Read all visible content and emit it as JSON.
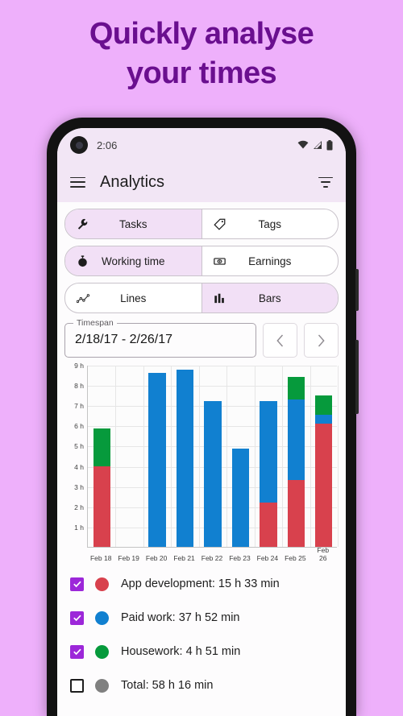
{
  "headline": {
    "line1": "Quickly analyse",
    "line2": "your times",
    "color": "#6a0f8f"
  },
  "status_bar": {
    "time": "2:06",
    "icons": [
      "wifi-icon",
      "signal-icon",
      "battery-icon"
    ]
  },
  "app_bar": {
    "title": "Analytics",
    "menu_icon": "hamburger-menu-icon",
    "filter_icon": "filter-icon"
  },
  "toggles": [
    {
      "left": {
        "label": "Tasks",
        "icon": "wrench-icon",
        "selected": true
      },
      "right": {
        "label": "Tags",
        "icon": "tag-icon",
        "selected": false
      }
    },
    {
      "left": {
        "label": "Working time",
        "icon": "stopwatch-icon",
        "selected": true
      },
      "right": {
        "label": "Earnings",
        "icon": "money-icon",
        "selected": false
      }
    },
    {
      "left": {
        "label": "Lines",
        "icon": "line-chart-icon",
        "selected": false
      },
      "right": {
        "label": "Bars",
        "icon": "bar-chart-icon",
        "selected": true
      }
    }
  ],
  "timespan": {
    "label": "Timespan",
    "value": "2/18/17 - 2/26/17",
    "prev_label": "‹",
    "next_label": "›"
  },
  "chart_data": {
    "type": "bar",
    "stacked": true,
    "title": "",
    "xlabel": "",
    "ylabel": "",
    "ylim": [
      0,
      9
    ],
    "yticks": [
      1,
      2,
      3,
      4,
      5,
      6,
      7,
      8,
      9
    ],
    "ytick_labels": [
      "1 h",
      "2 h",
      "3 h",
      "4 h",
      "5 h",
      "6 h",
      "7 h",
      "8 h",
      "9 h"
    ],
    "grid": true,
    "legend_position": "below",
    "categories": [
      "Feb 18",
      "Feb 19",
      "Feb 20",
      "Feb 21",
      "Feb 22",
      "Feb 23",
      "Feb 24",
      "Feb 25",
      "Feb 26"
    ],
    "series": [
      {
        "name": "App development",
        "color": "#d8414d",
        "values": [
          4.0,
          0,
          0,
          0,
          0,
          0,
          2.2,
          3.3,
          6.1
        ]
      },
      {
        "name": "Paid work",
        "color": "#1180d0",
        "values": [
          0,
          0,
          8.6,
          8.75,
          7.2,
          4.85,
          5.0,
          4.0,
          0.45
        ]
      },
      {
        "name": "Housework",
        "color": "#069a3c",
        "values": [
          1.85,
          0,
          0,
          0,
          0,
          0,
          0,
          1.1,
          0.95
        ]
      }
    ]
  },
  "legend": [
    {
      "label": "App development: 15 h 33 min",
      "color": "#d8414d",
      "checked": true
    },
    {
      "label": "Paid work: 37 h 52 min",
      "color": "#1180d0",
      "checked": true
    },
    {
      "label": "Housework: 4 h 51 min",
      "color": "#069a3c",
      "checked": true
    },
    {
      "label": "Total: 58 h 16 min",
      "color": "#808080",
      "checked": false
    }
  ]
}
